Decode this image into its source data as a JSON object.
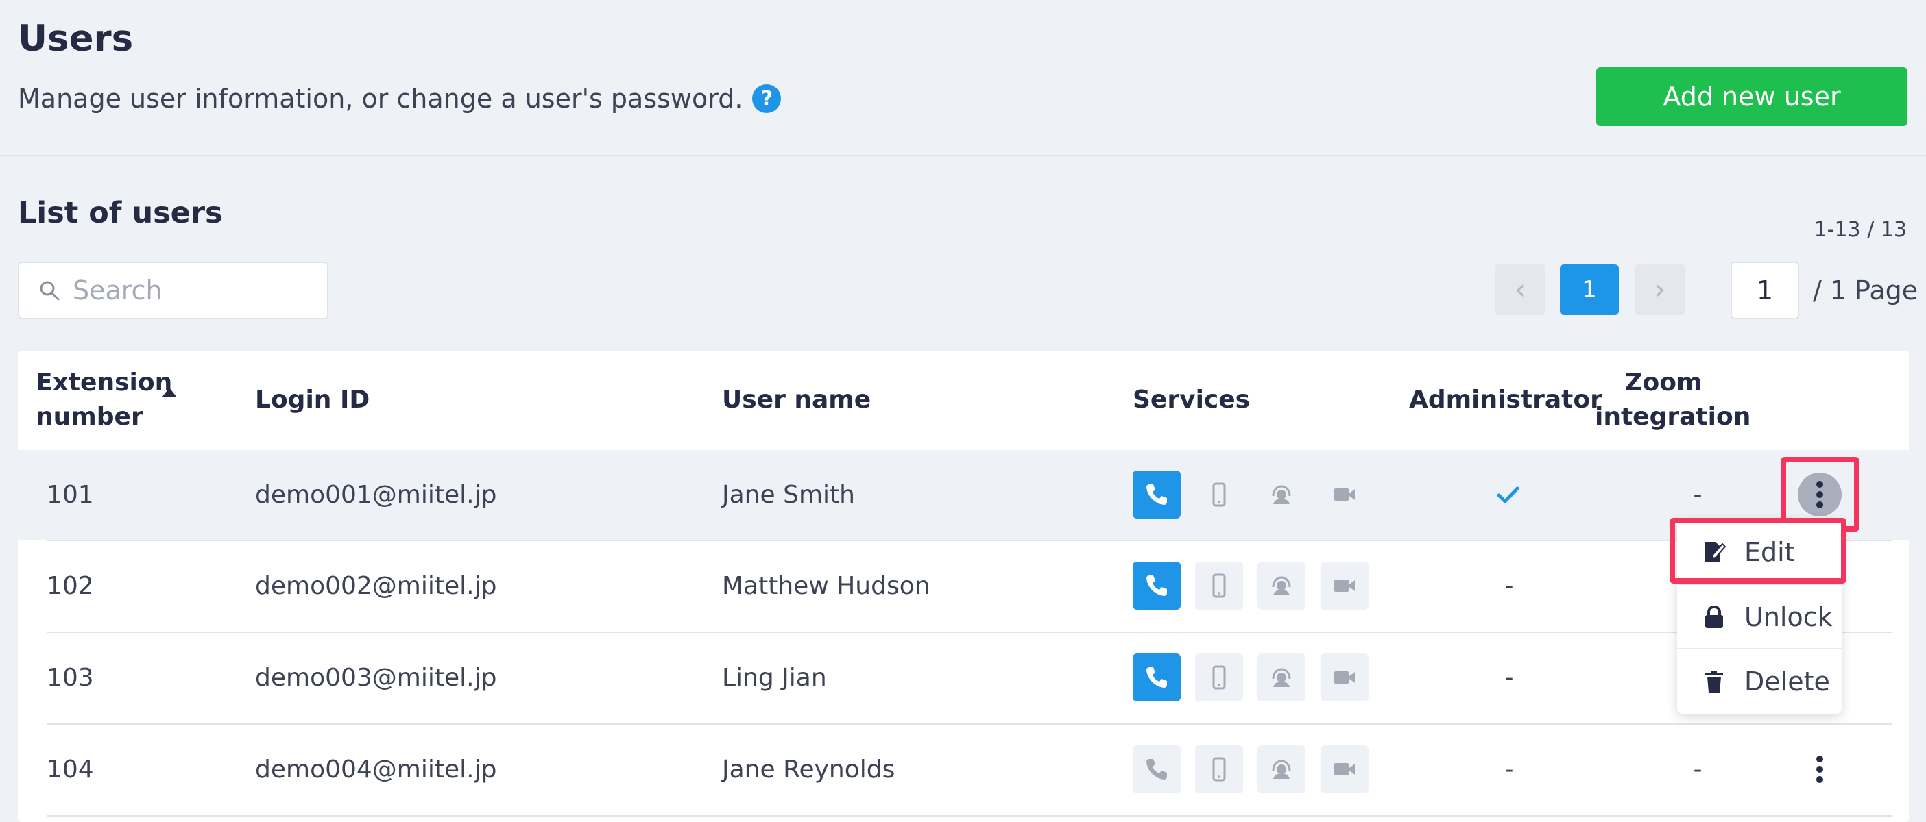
{
  "header": {
    "title": "Users",
    "subtitle": "Manage user information, or change a user's password.",
    "help_icon": "?",
    "add_button_label": "Add new user"
  },
  "list": {
    "title": "List of users",
    "count": "1-13 / 13",
    "search_placeholder": "Search",
    "pagination": {
      "prev": "‹",
      "next": "›",
      "current_page": "1",
      "page_input": "1",
      "total_label": "/ 1 Page"
    }
  },
  "table": {
    "columns": {
      "extension": "Extension\nnumber",
      "login_id": "Login ID",
      "user_name": "User name",
      "services": "Services",
      "administrator": "Administrator",
      "zoom": "Zoom\nintegration"
    },
    "sort": {
      "column": "extension",
      "direction": "ascending"
    },
    "rows": [
      {
        "extension": "101",
        "login_id": "demo001@miitel.jp",
        "user_name": "Jane Smith",
        "services": [
          "phone"
        ],
        "administrator": true,
        "zoom": "-"
      },
      {
        "extension": "102",
        "login_id": "demo002@miitel.jp",
        "user_name": "Matthew Hudson",
        "services": [
          "phone"
        ],
        "administrator": false,
        "admin_text": "-"
      },
      {
        "extension": "103",
        "login_id": "demo003@miitel.jp",
        "user_name": "Ling Jian",
        "services": [
          "phone"
        ],
        "administrator": false,
        "admin_text": "-"
      },
      {
        "extension": "104",
        "login_id": "demo004@miitel.jp",
        "user_name": "Jane Reynolds",
        "services": [],
        "administrator": false,
        "admin_text": "-",
        "zoom": "-"
      }
    ],
    "service_icons": [
      "phone-icon",
      "mobile-icon",
      "headset-icon",
      "video-icon"
    ]
  },
  "row_menu": {
    "items": [
      {
        "label": "Edit",
        "icon": "edit-icon"
      },
      {
        "label": "Unlock",
        "icon": "lock-icon"
      },
      {
        "label": "Delete",
        "icon": "trash-icon"
      }
    ]
  },
  "colors": {
    "accent": "#1f95e8",
    "add_button": "#1fbf4f",
    "highlight": "#f2365e",
    "background": "#eef1f5"
  }
}
